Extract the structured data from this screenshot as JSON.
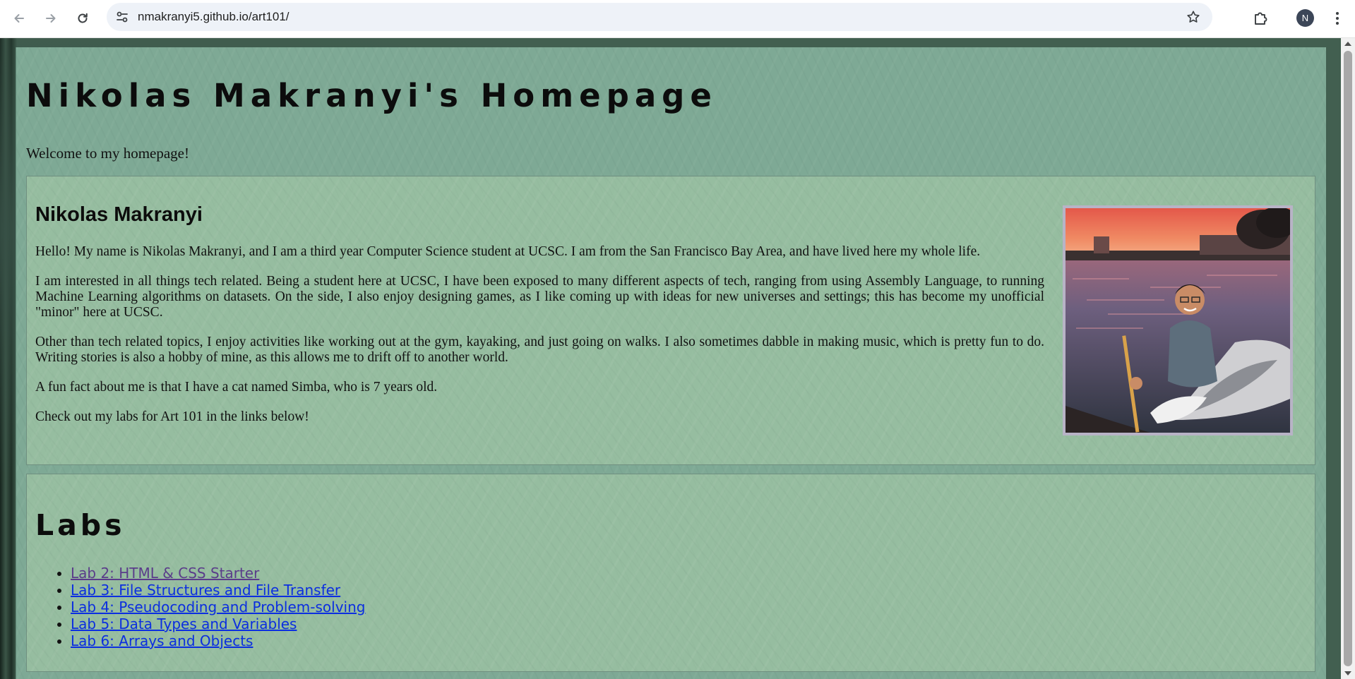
{
  "browser": {
    "url": "nmakranyi5.github.io/art101/",
    "profile_initial": "N",
    "icons": {
      "back": "arrow-left-icon",
      "forward": "arrow-right-icon",
      "reload": "reload-icon",
      "site_info": "tune-icon",
      "bookmark": "star-icon",
      "extensions": "puzzle-icon",
      "menu": "kebab-menu-icon"
    }
  },
  "page": {
    "title": "Nikolas Makranyi's Homepage",
    "welcome": "Welcome to my homepage!"
  },
  "about": {
    "heading": "Nikolas Makranyi",
    "paragraphs": [
      "Hello! My name is Nikolas Makranyi, and I am a third year Computer Science student at UCSC. I am from the San Francisco Bay Area, and have lived here my whole life.",
      "I am interested in all things tech related. Being a student here at UCSC, I have been exposed to many different aspects of tech, ranging from using Assembly Language, to running Machine Learning algorithms on datasets. On the side, I also enjoy designing games, as I like coming up with ideas for new universes and settings; this has become my unofficial \"minor\" here at UCSC.",
      "Other than tech related topics, I enjoy activities like working out at the gym, kayaking, and just going on walks. I also sometimes dabble in making music, which is pretty fun to do. Writing stories is also a hobby of mine, as this allows me to drift off to another world.",
      "A fun fact about me is that I have a cat named Simba, who is 7 years old.",
      "Check out my labs for Art 101 in the links below!"
    ]
  },
  "labs": {
    "heading": "Labs",
    "items": [
      {
        "label": "Lab 2: HTML & CSS Starter",
        "visited": true
      },
      {
        "label": "Lab 3: File Structures and File Transfer",
        "visited": false
      },
      {
        "label": "Lab 4: Pseudocoding and Problem-solving",
        "visited": false
      },
      {
        "label": "Lab 5: Data Types and Variables",
        "visited": false
      },
      {
        "label": "Lab 6: Arrays and Objects",
        "visited": false
      }
    ]
  },
  "colors": {
    "page_bg": "#7ea995",
    "card_bg": "#a9cca9",
    "link": "#0b2ee0",
    "link_visited": "#5a3c8a"
  }
}
